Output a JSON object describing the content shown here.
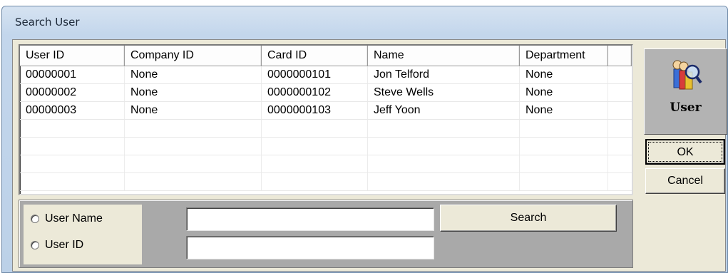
{
  "window": {
    "title": "Search User"
  },
  "list": {
    "columns": [
      "User ID",
      "Company ID",
      "Card ID",
      "Name",
      "Department"
    ],
    "rows": [
      [
        "00000001",
        "None",
        "0000000101",
        "Jon Telford",
        "None"
      ],
      [
        "00000002",
        "None",
        "0000000102",
        "Steve Wells",
        "None"
      ],
      [
        "00000003",
        "None",
        "0000000103",
        "Jeff Yoon",
        "None"
      ]
    ]
  },
  "search": {
    "radio_user_name": "User Name",
    "radio_user_id": "User ID",
    "user_name_value": "",
    "user_id_value": "",
    "search_label": "Search"
  },
  "side": {
    "user_label": "User",
    "user_icon": "user-search-icon",
    "ok_label": "OK",
    "cancel_label": "Cancel"
  }
}
